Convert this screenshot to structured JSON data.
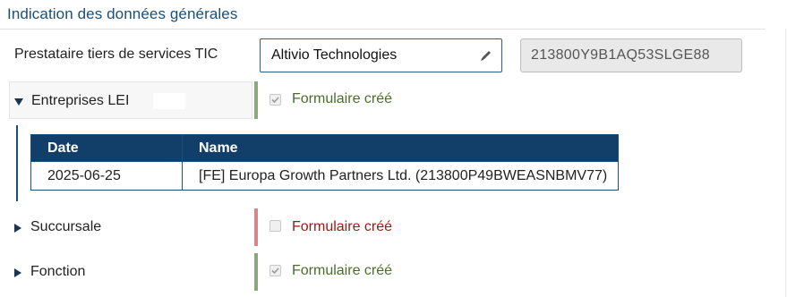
{
  "section": {
    "title": "Indication des données générales"
  },
  "provider": {
    "label": "Prestataire tiers de services TIC",
    "name_value": "Altivio Technologies",
    "lei_value": "213800Y9B1AQ53SLGE88"
  },
  "rows": [
    {
      "label": "Entreprises LEI",
      "expanded": true,
      "status_text": "Formulaire créé",
      "status": "ok",
      "checked": true
    },
    {
      "label": "Succursale",
      "expanded": false,
      "status_text": "Formulaire créé",
      "status": "bad",
      "checked": false
    },
    {
      "label": "Fonction",
      "expanded": false,
      "status_text": "Formulaire créé",
      "status": "ok",
      "checked": true
    }
  ],
  "lei_table": {
    "headers": [
      "Date",
      "Name"
    ],
    "rows": [
      [
        "2025-06-25",
        "[FE] Europa Growth Partners Ltd. (213800P49BWEASNBMV77)"
      ]
    ]
  },
  "colors": {
    "brand": "#123f6a",
    "ok": "#8aa97c",
    "bad": "#d88686"
  },
  "icons": {
    "edit": "pencil-icon",
    "expanded": "caret-down-icon",
    "collapsed": "caret-right-icon"
  }
}
